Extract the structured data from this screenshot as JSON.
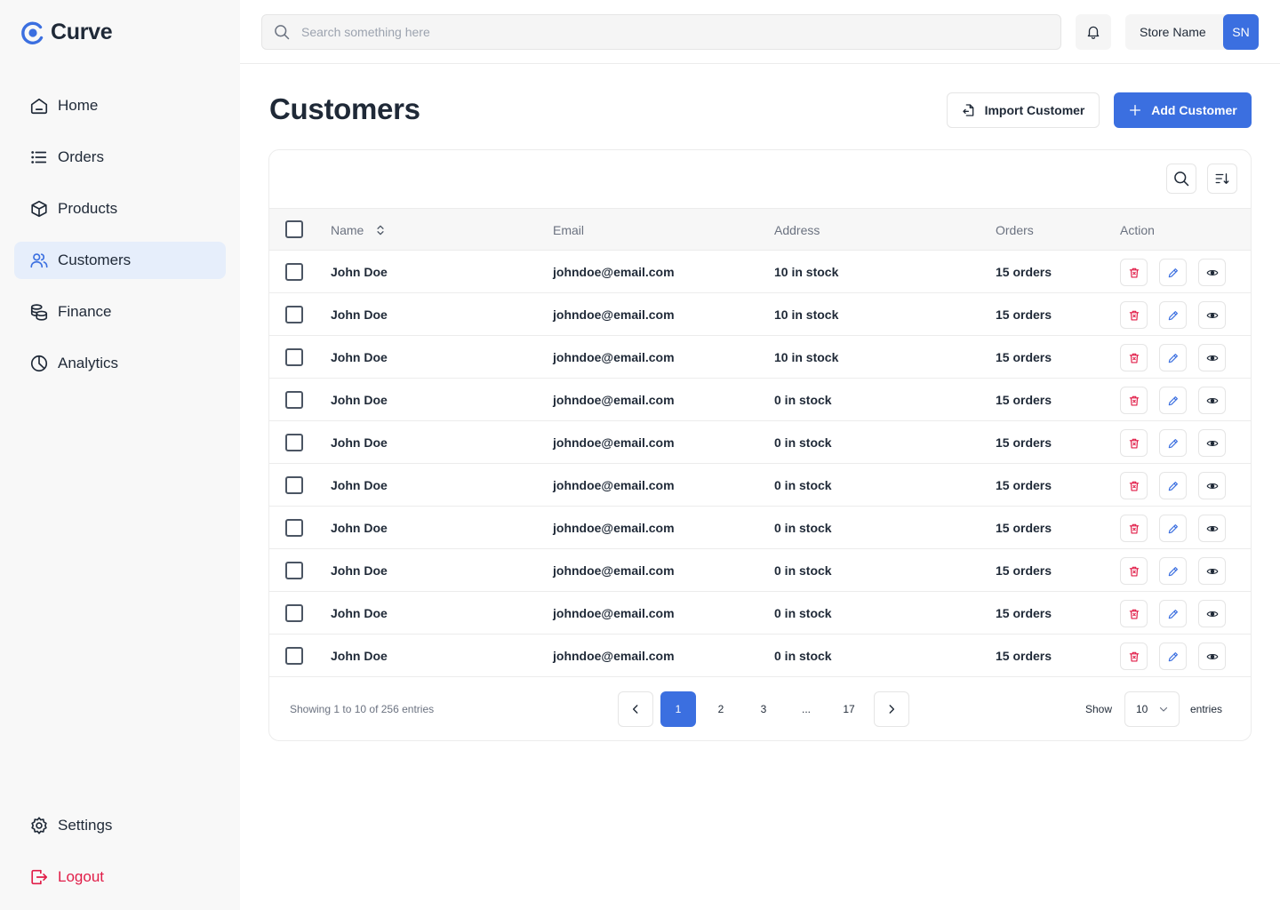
{
  "app": {
    "name": "Curve"
  },
  "sidebar": {
    "items": [
      {
        "label": "Home"
      },
      {
        "label": "Orders"
      },
      {
        "label": "Products"
      },
      {
        "label": "Customers"
      },
      {
        "label": "Finance"
      },
      {
        "label": "Analytics"
      }
    ],
    "settings_label": "Settings",
    "logout_label": "Logout"
  },
  "topbar": {
    "search_placeholder": "Search something here",
    "store_name": "Store Name",
    "store_initials": "SN"
  },
  "page": {
    "title": "Customers",
    "import_label": "Import Customer",
    "add_label": "Add Customer"
  },
  "table": {
    "columns": {
      "name": "Name",
      "email": "Email",
      "address": "Address",
      "orders": "Orders",
      "action": "Action"
    },
    "rows": [
      {
        "name": "John Doe",
        "email": "johndoe@email.com",
        "address": "10 in stock",
        "orders": "15 orders"
      },
      {
        "name": "John Doe",
        "email": "johndoe@email.com",
        "address": "10 in stock",
        "orders": "15 orders"
      },
      {
        "name": "John Doe",
        "email": "johndoe@email.com",
        "address": "10 in stock",
        "orders": "15 orders"
      },
      {
        "name": "John Doe",
        "email": "johndoe@email.com",
        "address": "0 in stock",
        "orders": "15 orders"
      },
      {
        "name": "John Doe",
        "email": "johndoe@email.com",
        "address": "0 in stock",
        "orders": "15 orders"
      },
      {
        "name": "John Doe",
        "email": "johndoe@email.com",
        "address": "0 in stock",
        "orders": "15 orders"
      },
      {
        "name": "John Doe",
        "email": "johndoe@email.com",
        "address": "0 in stock",
        "orders": "15 orders"
      },
      {
        "name": "John Doe",
        "email": "johndoe@email.com",
        "address": "0 in stock",
        "orders": "15 orders"
      },
      {
        "name": "John Doe",
        "email": "johndoe@email.com",
        "address": "0 in stock",
        "orders": "15 orders"
      },
      {
        "name": "John Doe",
        "email": "johndoe@email.com",
        "address": "0 in stock",
        "orders": "15 orders"
      }
    ]
  },
  "pagination": {
    "showing_text": "Showing 1 to 10 of 256 entries",
    "pages": [
      "1",
      "2",
      "3",
      "...",
      "17"
    ],
    "current_page": "1",
    "show_label": "Show",
    "entries_value": "10",
    "entries_label": "entries"
  },
  "colors": {
    "accent": "#3b6fe0",
    "active_nav_bg": "#e6eefb",
    "danger": "#e11d48",
    "sidebar_bg": "#f8f8f8"
  },
  "icons": {
    "logo": "curve-logo-icon",
    "nav": [
      "home-icon",
      "list-icon",
      "box-icon",
      "users-icon",
      "coins-icon",
      "pie-chart-icon"
    ],
    "settings": "gear-icon",
    "logout": "logout-icon",
    "search": "search-icon",
    "notifications": "bell-icon",
    "import": "file-import-icon",
    "add": "plus-icon",
    "sort": "sort-icon",
    "row_actions": [
      "trash-icon",
      "pencil-icon",
      "eye-icon"
    ]
  }
}
